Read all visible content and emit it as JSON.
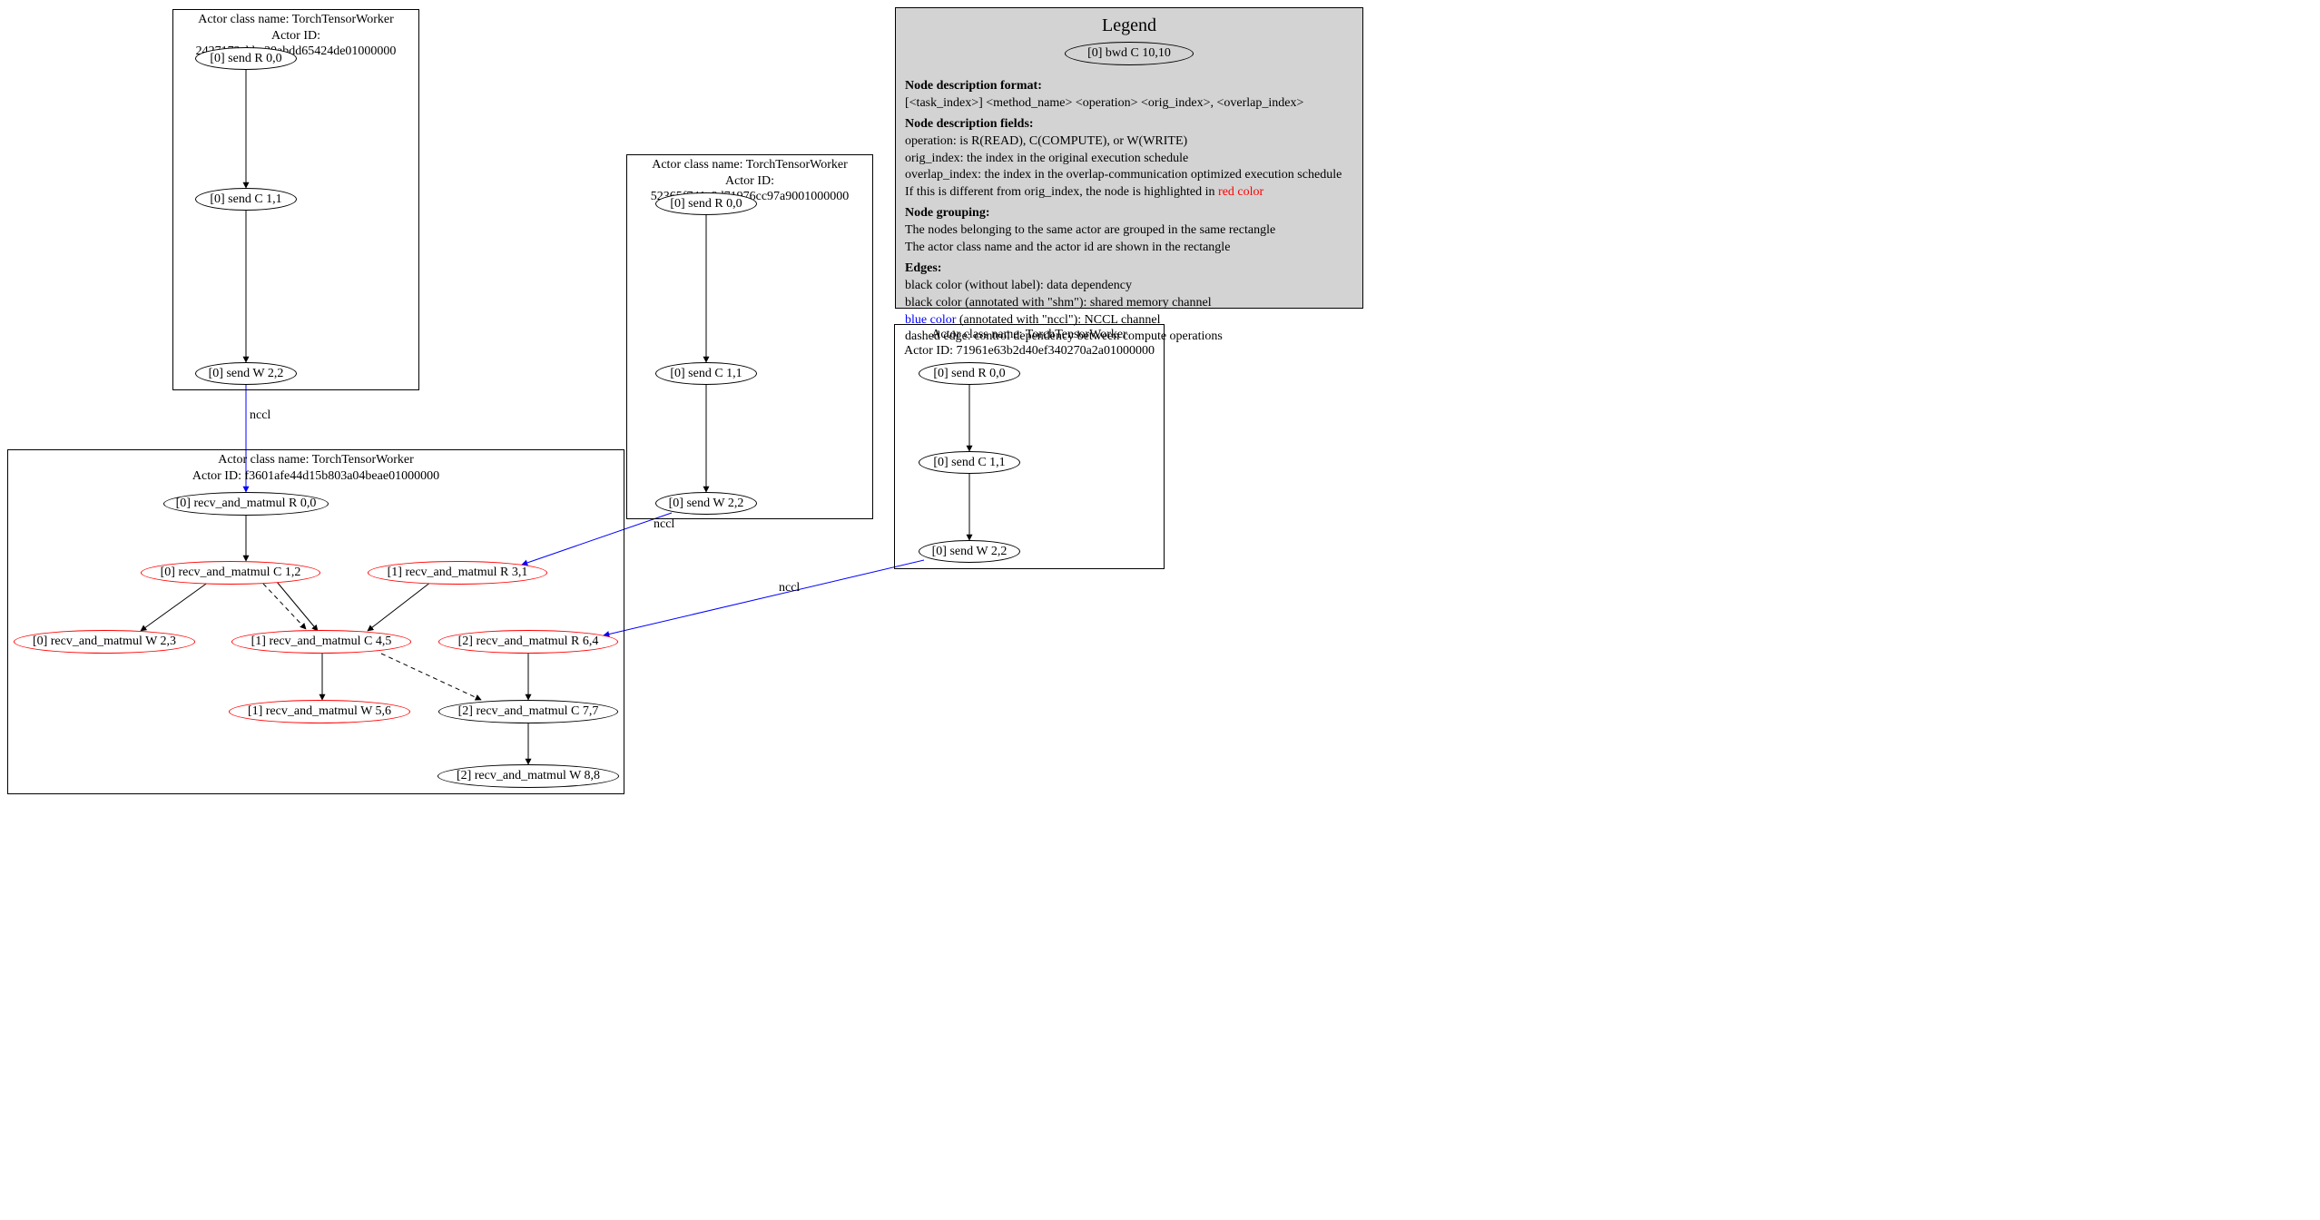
{
  "actors": {
    "a1": {
      "class": "TorchTensorWorker",
      "id": "2427172cbbe30abdd65424de01000000"
    },
    "a2": {
      "class": "TorchTensorWorker",
      "id": "52365f741e9d71976cc97a9001000000"
    },
    "a3": {
      "class": "TorchTensorWorker",
      "id": "71961e63b2d40ef340270a2a01000000"
    },
    "a4": {
      "class": "TorchTensorWorker",
      "id": "f3601afe44d15b803a04beae01000000"
    }
  },
  "actor_label_prefix": {
    "class": "Actor class name: ",
    "id": "Actor ID: "
  },
  "nodes": {
    "a1n0": "[0] send R 0,0",
    "a1n1": "[0] send C 1,1",
    "a1n2": "[0] send W 2,2",
    "a2n0": "[0] send R 0,0",
    "a2n1": "[0] send C 1,1",
    "a2n2": "[0] send W 2,2",
    "a3n0": "[0] send R 0,0",
    "a3n1": "[0] send C 1,1",
    "a3n2": "[0] send W 2,2",
    "a4n0": "[0] recv_and_matmul R 0,0",
    "a4n1": "[0] recv_and_matmul C 1,2",
    "a4n2": "[1] recv_and_matmul R 3,1",
    "a4n3": "[0] recv_and_matmul W 2,3",
    "a4n4": "[1] recv_and_matmul C 4,5",
    "a4n5": "[2] recv_and_matmul R 6,4",
    "a4n6": "[1] recv_and_matmul W 5,6",
    "a4n7": "[2] recv_and_matmul C 7,7",
    "a4n8": "[2] recv_and_matmul W 8,8"
  },
  "edge_labels": {
    "nccl1": "nccl",
    "nccl2": "nccl",
    "nccl3": "nccl"
  },
  "legend": {
    "title": "Legend",
    "example_node": "[0] bwd C 10,10",
    "h1": "Node description format:",
    "l1": "[<task_index>] <method_name> <operation> <orig_index>, <overlap_index>",
    "h2": "Node description fields:",
    "l2a": "operation: is R(READ), C(COMPUTE), or W(WRITE)",
    "l2b": "orig_index: the index in the original execution schedule",
    "l2c": "overlap_index: the index in the overlap-communication optimized execution schedule",
    "l2d_pre": "If this is different from orig_index, the node is highlighted in ",
    "l2d_red": "red color",
    "h3": "Node grouping:",
    "l3a": "The nodes belonging to the same actor are grouped in the same rectangle",
    "l3b": "The actor class name and the actor id are shown in the rectangle",
    "h4": "Edges:",
    "l4a": "black color (without label): data dependency",
    "l4b": "black color (annotated with \"shm\"): shared memory channel",
    "l4c_blue": "blue color",
    "l4c_rest": " (annotated with \"nccl\"): NCCL channel",
    "l4d": "dashed edge: control dependency between compute operations"
  }
}
